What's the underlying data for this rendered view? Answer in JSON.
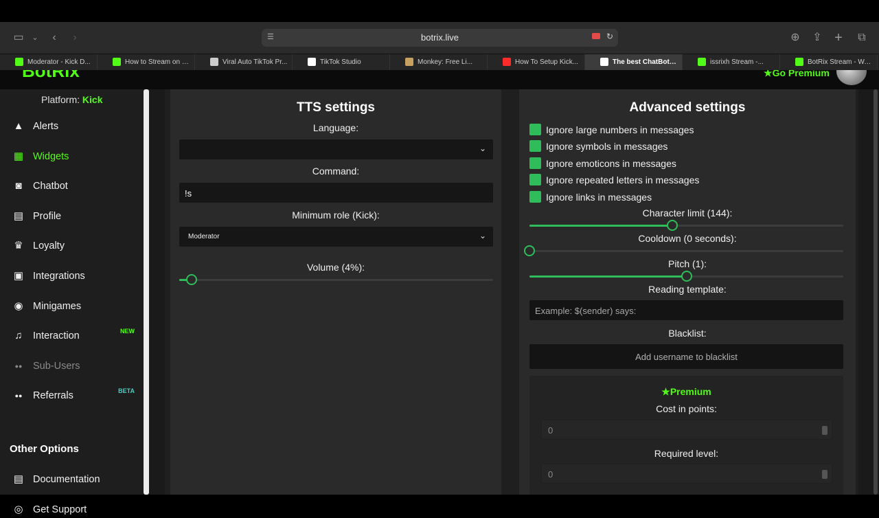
{
  "browser": {
    "url": "botrix.live",
    "tabs": [
      {
        "title": "Moderator - Kick D...",
        "color": "#53fc18",
        "active": false
      },
      {
        "title": "How to Stream on K...",
        "color": "#53fc18",
        "active": false
      },
      {
        "title": "Viral Auto TikTok Pr...",
        "color": "#cccccc",
        "active": false
      },
      {
        "title": "TikTok Studio",
        "color": "#ffffff",
        "active": false
      },
      {
        "title": "Monkey: Free Li...",
        "color": "#c8a060",
        "active": false
      },
      {
        "title": "How To Setup Kick...",
        "color": "#ff2b2b",
        "active": false
      },
      {
        "title": "The best ChatBot a...",
        "color": "#ffffff",
        "active": true
      },
      {
        "title": "issrixh Stream -...",
        "color": "#53fc18",
        "active": false
      },
      {
        "title": "BotRix Stream - Wa...",
        "color": "#53fc18",
        "active": false
      }
    ]
  },
  "header": {
    "logo": "BotRix",
    "premium_link": "Go Premium"
  },
  "sidebar": {
    "platform_label": "Platform:",
    "platform_value": "Kick",
    "items": [
      {
        "label": "Alerts",
        "icon": "warning-icon"
      },
      {
        "label": "Widgets",
        "icon": "widgets-icon"
      },
      {
        "label": "Chatbot",
        "icon": "robot-icon"
      },
      {
        "label": "Profile",
        "icon": "id-card-icon"
      },
      {
        "label": "Loyalty",
        "icon": "trophy-icon"
      },
      {
        "label": "Integrations",
        "icon": "integrations-icon"
      },
      {
        "label": "Minigames",
        "icon": "gamepad-icon"
      },
      {
        "label": "Interaction",
        "icon": "music-icon",
        "badge": "NEW"
      },
      {
        "label": "Sub-Users",
        "icon": "users-icon"
      },
      {
        "label": "Referrals",
        "icon": "referrals-icon",
        "badge": "BETA"
      }
    ],
    "other_title": "Other Options",
    "other_items": [
      {
        "label": "Documentation",
        "icon": "document-icon"
      },
      {
        "label": "Get Support",
        "icon": "support-icon"
      }
    ]
  },
  "tts": {
    "title": "TTS settings",
    "language_label": "Language:",
    "language_value": "",
    "command_label": "Command:",
    "command_value": "!s",
    "role_label": "Minimum role (Kick):",
    "role_value": "Moderator",
    "volume_label": "Volume (4%):",
    "volume_value": 0.04
  },
  "advanced": {
    "title": "Advanced settings",
    "checkboxes": [
      "Ignore large numbers in messages",
      "Ignore symbols in messages",
      "Ignore emoticons in messages",
      "Ignore repeated letters in messages",
      "Ignore links in messages"
    ],
    "char_limit_label": "Character limit (144):",
    "char_limit_fraction": 0.455,
    "cooldown_label": "Cooldown (0 seconds):",
    "cooldown_fraction": 0,
    "pitch_label": "Pitch (1):",
    "pitch_fraction": 0.5,
    "template_label": "Reading template:",
    "template_placeholder": "Example: $(sender) says:",
    "blacklist_label": "Blacklist:",
    "blacklist_placeholder": "Add username to blacklist",
    "premium_title": "Premium",
    "cost_label": "Cost in points:",
    "cost_value": "0",
    "level_label": "Required level:",
    "level_value": "0"
  },
  "colors": {
    "accent": "#53fc18",
    "checkbox": "#2ebd59"
  }
}
